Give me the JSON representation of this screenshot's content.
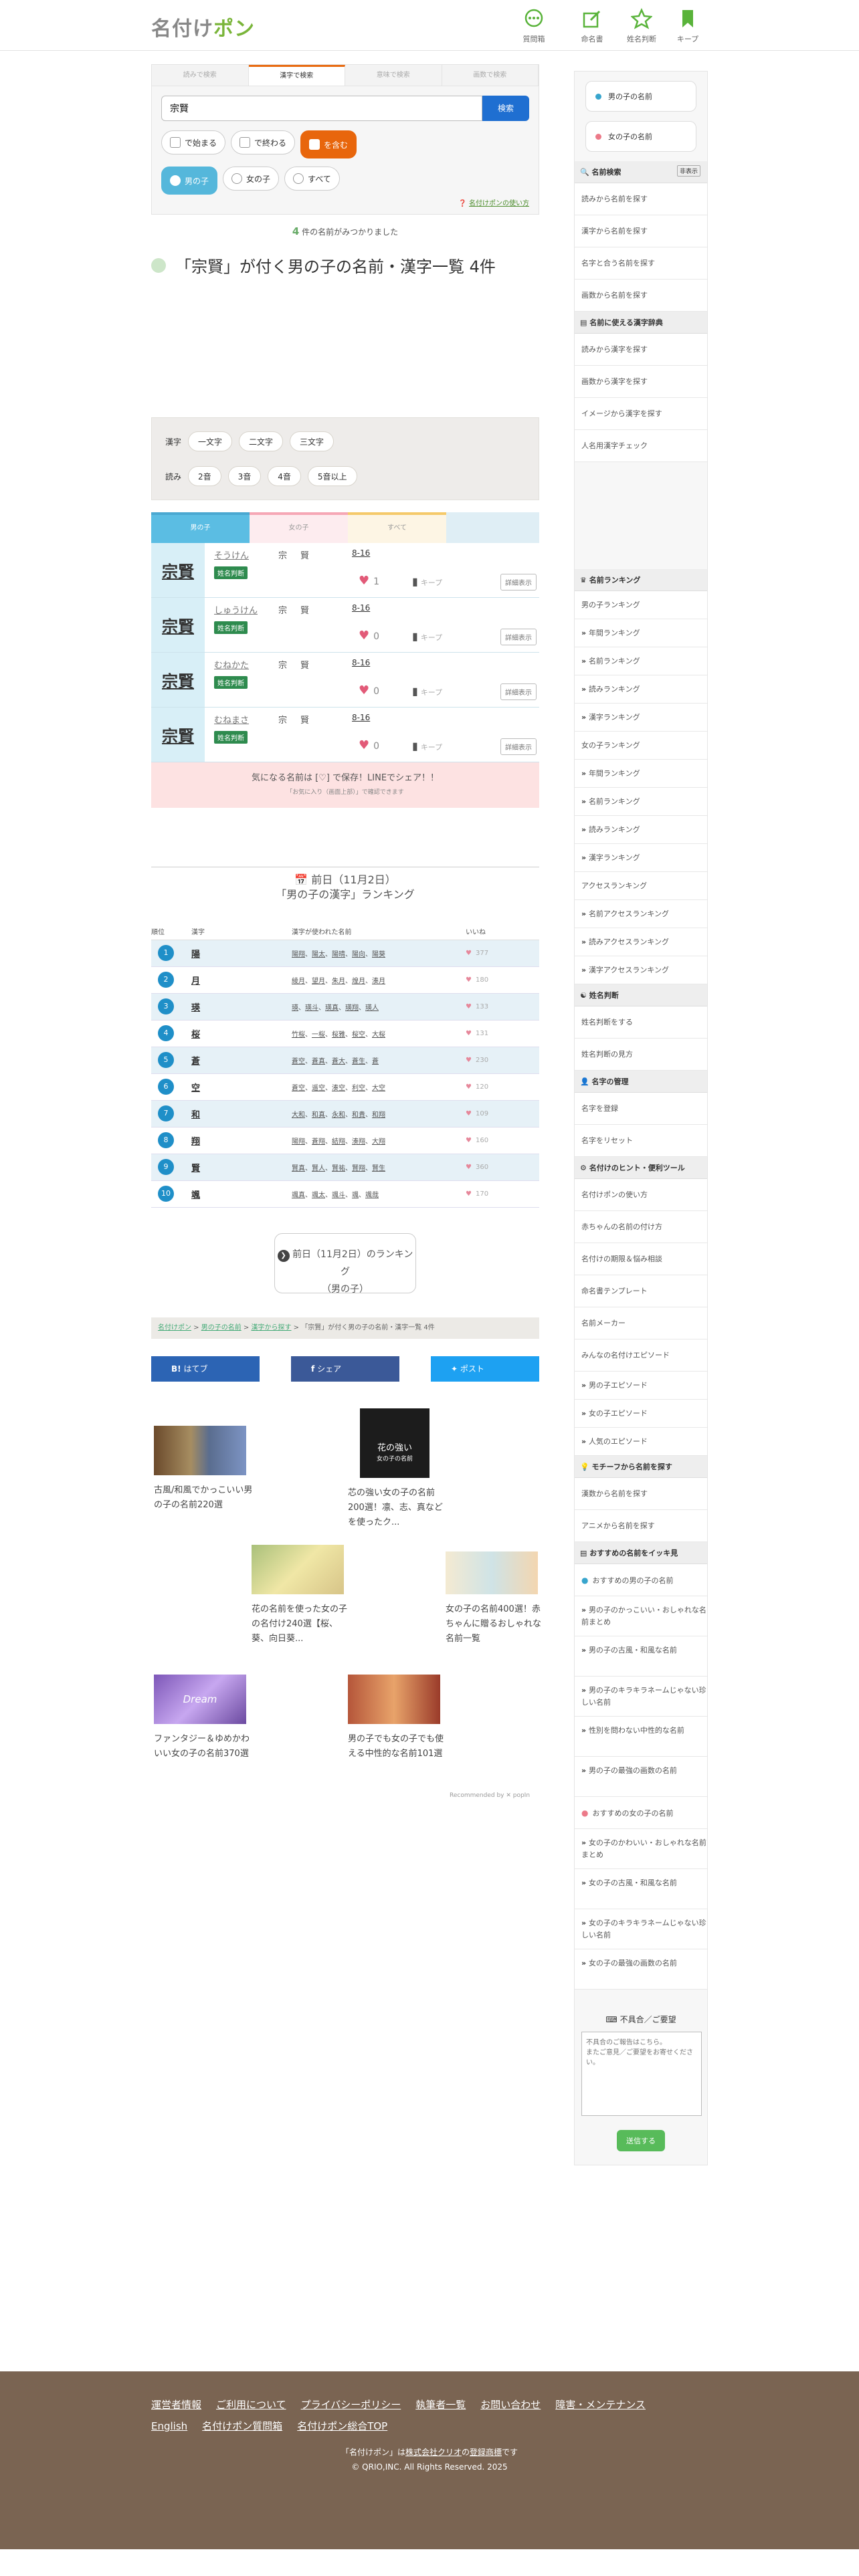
{
  "header": {
    "logo_main": "名付け",
    "logo_accent": "ポン",
    "nav": [
      {
        "label": "質問箱",
        "icon": "chat-icon"
      },
      {
        "label": "命名書",
        "icon": "edit-icon"
      },
      {
        "label": "姓名判断",
        "icon": "star-icon"
      },
      {
        "label": "キープ",
        "icon": "bookmark-icon"
      }
    ]
  },
  "search": {
    "tabs": [
      "読みで検索",
      "漢字で検索",
      "意味で検索",
      "画数で検索"
    ],
    "active_tab": 1,
    "query": "宗賢",
    "button": "検索",
    "position_options": [
      "で始まる",
      "で終わる",
      "を含む"
    ],
    "gender_options": [
      "男の子",
      "女の子",
      "すべて"
    ],
    "howto": "名付けポンの使い方"
  },
  "result": {
    "count": "4",
    "count_suffix": "件の名前がみつかりました",
    "title": "「宗賢」が付く男の子の名前・漢字一覧 4件"
  },
  "filters": {
    "kanji_label": "漢字",
    "kanji_opts": [
      "一文字",
      "二文字",
      "三文字"
    ],
    "reading_label": "読み",
    "reading_opts": [
      "2音",
      "3音",
      "4音",
      "5音以上"
    ]
  },
  "gender_tabs": [
    "男の子",
    "女の子",
    "すべて"
  ],
  "names": [
    {
      "kanji": "宗賢",
      "reading": "そうけん",
      "k1": "宗",
      "k2": "賢",
      "strokes": "8-16",
      "seimei": "姓名判断",
      "likes": "1",
      "keep": "キープ",
      "detail": "詳細表示"
    },
    {
      "kanji": "宗賢",
      "reading": "しゅうけん",
      "k1": "宗",
      "k2": "賢",
      "strokes": "8-16",
      "seimei": "姓名判断",
      "likes": "0",
      "keep": "キープ",
      "detail": "詳細表示"
    },
    {
      "kanji": "宗賢",
      "reading": "むねかた",
      "k1": "宗",
      "k2": "賢",
      "strokes": "8-16",
      "seimei": "姓名判断",
      "likes": "0",
      "keep": "キープ",
      "detail": "詳細表示"
    },
    {
      "kanji": "宗賢",
      "reading": "むねまさ",
      "k1": "宗",
      "k2": "賢",
      "strokes": "8-16",
      "seimei": "姓名判断",
      "likes": "0",
      "keep": "キープ",
      "detail": "詳細表示"
    }
  ],
  "line_banner": {
    "text": "気になる名前は [♡] で保存！LINEでシェア！！",
    "sub": "「お気に入り（画面上部）」で確認できます"
  },
  "ranking": {
    "date": "前日（11月2日）",
    "title": "「男の子の漢字」ランキング",
    "headers": [
      "順位",
      "漢字",
      "漢字が使われた名前",
      "いいね"
    ],
    "rows": [
      {
        "rank": "1",
        "kanji": "陽",
        "names": [
          "陽翔",
          "陽太",
          "陽晴",
          "陽向",
          "陽葵"
        ],
        "likes": "377"
      },
      {
        "rank": "2",
        "kanji": "月",
        "names": [
          "綾月",
          "望月",
          "朱月",
          "煌月",
          "湊月"
        ],
        "likes": "180"
      },
      {
        "rank": "3",
        "kanji": "瑛",
        "names": [
          "瑛",
          "瑛斗",
          "瑛真",
          "瑛翔",
          "瑛人"
        ],
        "likes": "133"
      },
      {
        "rank": "4",
        "kanji": "桜",
        "names": [
          "竹桜",
          "一桜",
          "桜雅",
          "桜空",
          "大桜"
        ],
        "likes": "131"
      },
      {
        "rank": "5",
        "kanji": "蒼",
        "names": [
          "蒼空",
          "蒼真",
          "蒼大",
          "蒼生",
          "蒼"
        ],
        "likes": "230"
      },
      {
        "rank": "6",
        "kanji": "空",
        "names": [
          "蒼空",
          "遥空",
          "湊空",
          "利空",
          "大空"
        ],
        "likes": "120"
      },
      {
        "rank": "7",
        "kanji": "和",
        "names": [
          "大和",
          "和真",
          "永和",
          "和貴",
          "和翔"
        ],
        "likes": "109"
      },
      {
        "rank": "8",
        "kanji": "翔",
        "names": [
          "陽翔",
          "蒼翔",
          "結翔",
          "湊翔",
          "大翔"
        ],
        "likes": "160"
      },
      {
        "rank": "9",
        "kanji": "賢",
        "names": [
          "賢真",
          "賢人",
          "賢祐",
          "賢翔",
          "賢生"
        ],
        "likes": "360"
      },
      {
        "rank": "10",
        "kanji": "颯",
        "names": [
          "颯真",
          "颯太",
          "颯斗",
          "颯",
          "颯哉"
        ],
        "likes": "170"
      }
    ],
    "prev_line1": "前日（11月2日）のランキング",
    "prev_line2": "（男の子）"
  },
  "breadcrumb": [
    "名付けポン",
    "男の子の名前",
    "漢字から探す",
    "「宗賢」が付く男の子の名前・漢字一覧 4件"
  ],
  "share": [
    {
      "label": "はてブ",
      "icon": "hatena-icon",
      "color": "#2c64b4"
    },
    {
      "label": "シェア",
      "icon": "facebook-icon",
      "color": "#3b5998"
    },
    {
      "label": "ポスト",
      "icon": "twitter-icon",
      "color": "#1da1f2"
    }
  ],
  "recommend": [
    "古風/和風でかっこいい男の子の名前220選",
    "芯の強い女の子の名前200選！凛、志、真などを使ったク...",
    "花の名前を使った女の子の名付け240選【桜、葵、向日葵...",
    "女の子の名前400選！赤ちゃんに贈るおしゃれな名前一覧",
    "ファンタジー＆ゆめかわいい女の子の名前370選",
    "男の子でも女の子でも使える中性的な名前101選"
  ],
  "rec_img_text": {
    "strong1": "花の強い",
    "strong2": "女の子の名前",
    "dream": "Dream"
  },
  "recommended_by": "Recommended by ✕ popIn",
  "sidebar": {
    "boy_btn": "男の子の名前",
    "girl_btn": "女の子の名前",
    "search_head": "名前検索",
    "hide": "非表示",
    "search_items": [
      "読みから名前を探す",
      "漢字から名前を探す",
      "名字と合う名前を探す",
      "画数から名前を探す"
    ],
    "dict_head": "名前に使える漢字辞典",
    "dict_items": [
      "読みから漢字を探す",
      "画数から漢字を探す",
      "イメージから漢字を探す",
      "人名用漢字チェック"
    ],
    "rank_head": "名前ランキング",
    "rank_boy": "男の子ランキング",
    "rank_boy_sub": [
      "年間ランキング",
      "名前ランキング",
      "読みランキング",
      "漢字ランキング"
    ],
    "rank_girl": "女の子ランキング",
    "rank_girl_sub": [
      "年間ランキング",
      "名前ランキング",
      "読みランキング",
      "漢字ランキング"
    ],
    "access": "アクセスランキング",
    "access_sub": [
      "名前アクセスランキング",
      "読みアクセスランキング",
      "漢字アクセスランキング"
    ],
    "seimei_head": "姓名判断",
    "seimei_items": [
      "姓名判断をする",
      "姓名判断の見方"
    ],
    "manage_head": "名字の管理",
    "manage_items": [
      "名字を登録",
      "名字をリセット"
    ],
    "tools_head": "名付けのヒント・便利ツール",
    "tools_items": [
      "名付けポンの使い方",
      "赤ちゃんの名前の付け方",
      "名付けの期限＆悩み相談",
      "命名書テンプレート",
      "名前メーカー",
      "みんなの名付けエピソード"
    ],
    "tools_sub": [
      "男の子エピソード",
      "女の子エピソード",
      "人気のエピソード"
    ],
    "motif_head": "モチーフから名前を探す",
    "motif_items": [
      "漢数から名前を探す",
      "アニメから名前を探す"
    ],
    "pick_head": "おすすめの名前をイッキ見",
    "pick_boy": "おすすめの男の子の名前",
    "pick_boy_sub": [
      "男の子のかっこいい・おしゃれな名前まとめ",
      "男の子の古風・和風な名前",
      "男の子のキラキラネームじゃない珍しい名前",
      "性別を問わない中性的な名前",
      "男の子の最強の画数の名前"
    ],
    "pick_girl": "おすすめの女の子の名前",
    "pick_girl_sub": [
      "女の子のかわいい・おしゃれな名前まとめ",
      "女の子の古風・和風な名前",
      "女の子のキラキラネームじゃない珍しい名前",
      "女の子の最強の画数の名前"
    ],
    "feedback_title": "不具合／ご要望",
    "feedback_placeholder": "不具合のご報告はこちら。\nまたご意見／ご要望をお寄せください。",
    "send": "送信する"
  },
  "footer": {
    "links": [
      "運営者情報",
      "ご利用について",
      "プライバシーポリシー",
      "執筆者一覧",
      "お問い合わせ",
      "障害・メンテナンス",
      "English",
      "名付けポン質問箱",
      "名付けポン総合TOP"
    ],
    "note_pre": "「名付けポン」は",
    "note_link1": "株式会社クリオ",
    "note_mid": "の",
    "note_link2": "登録商標",
    "note_post": "です",
    "copyright": "© QRIO,INC. All Rights Reserved. 2025"
  }
}
